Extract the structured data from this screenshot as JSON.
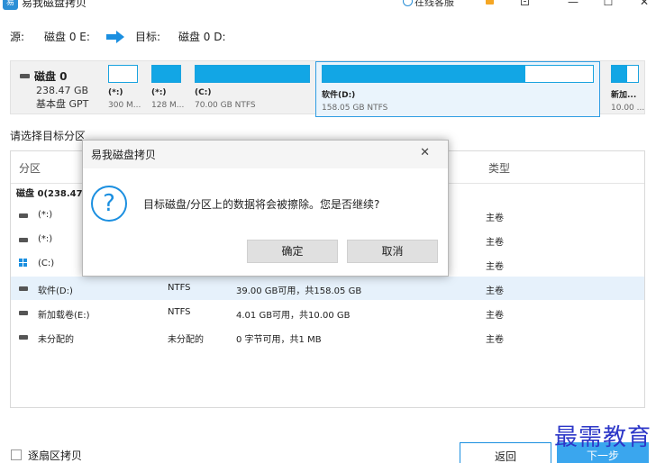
{
  "window": {
    "logo_text": "易",
    "title": "易我磁盘拷贝",
    "service_label": "在线客服",
    "minimize": "—",
    "maximize": "☐",
    "close": "✕"
  },
  "route": {
    "source_label": "源:",
    "source_value": "磁盘 0 E:",
    "target_label": "目标:",
    "target_value": "磁盘 0 D:"
  },
  "disk": {
    "name": "磁盘 0",
    "size": "238.47 GB",
    "type": "基本盘 GPT",
    "partitions": [
      {
        "label": "(*:)",
        "sub": "300 M...",
        "used_fraction": 0.0
      },
      {
        "label": "(*:)",
        "sub": "128 M...",
        "used_fraction": 1.0
      },
      {
        "label": "(C:)",
        "sub": "70.00 GB NTFS",
        "used_fraction": 1.0
      },
      {
        "label": "软件(D:)",
        "sub": "158.05 GB NTFS",
        "used_fraction": 0.75
      },
      {
        "label": "新加...",
        "sub": "10.00 ...",
        "used_fraction": 0.6
      }
    ]
  },
  "list": {
    "choose_label": "请选择目标分区",
    "headers": {
      "partition": "分区",
      "type": "类型"
    },
    "group": "磁盘 0(238.47 G",
    "rows": [
      {
        "name": "(*:)",
        "fs": "",
        "capacity": "",
        "type": "主卷"
      },
      {
        "name": "(*:)",
        "fs": "",
        "capacity": "",
        "type": "主卷"
      },
      {
        "name": "(C:)",
        "fs": "",
        "capacity": "",
        "type": "主卷"
      },
      {
        "name": "软件(D:)",
        "fs": "NTFS",
        "capacity": "39.00 GB可用，共158.05 GB",
        "type": "主卷"
      },
      {
        "name": "新加载卷(E:)",
        "fs": "NTFS",
        "capacity": "4.01 GB可用，共10.00 GB",
        "type": "主卷"
      },
      {
        "name": "未分配的",
        "fs": "未分配的",
        "capacity": "0 字节可用，共1 MB",
        "type": "主卷"
      }
    ]
  },
  "dialog": {
    "title": "易我磁盘拷贝",
    "close": "✕",
    "icon_glyph": "?",
    "message": "目标磁盘/分区上的数据将会被擦除。您是否继续?",
    "confirm": "确定",
    "cancel": "取消"
  },
  "footer": {
    "sector_copy": "逐扇区拷贝",
    "back": "返回",
    "next": "下一步",
    "watermark": "最需教育"
  },
  "colors": {
    "accent": "#1b8fe0",
    "partition_fill": "#12a6e5",
    "selected_row": "#e6f1fb"
  }
}
